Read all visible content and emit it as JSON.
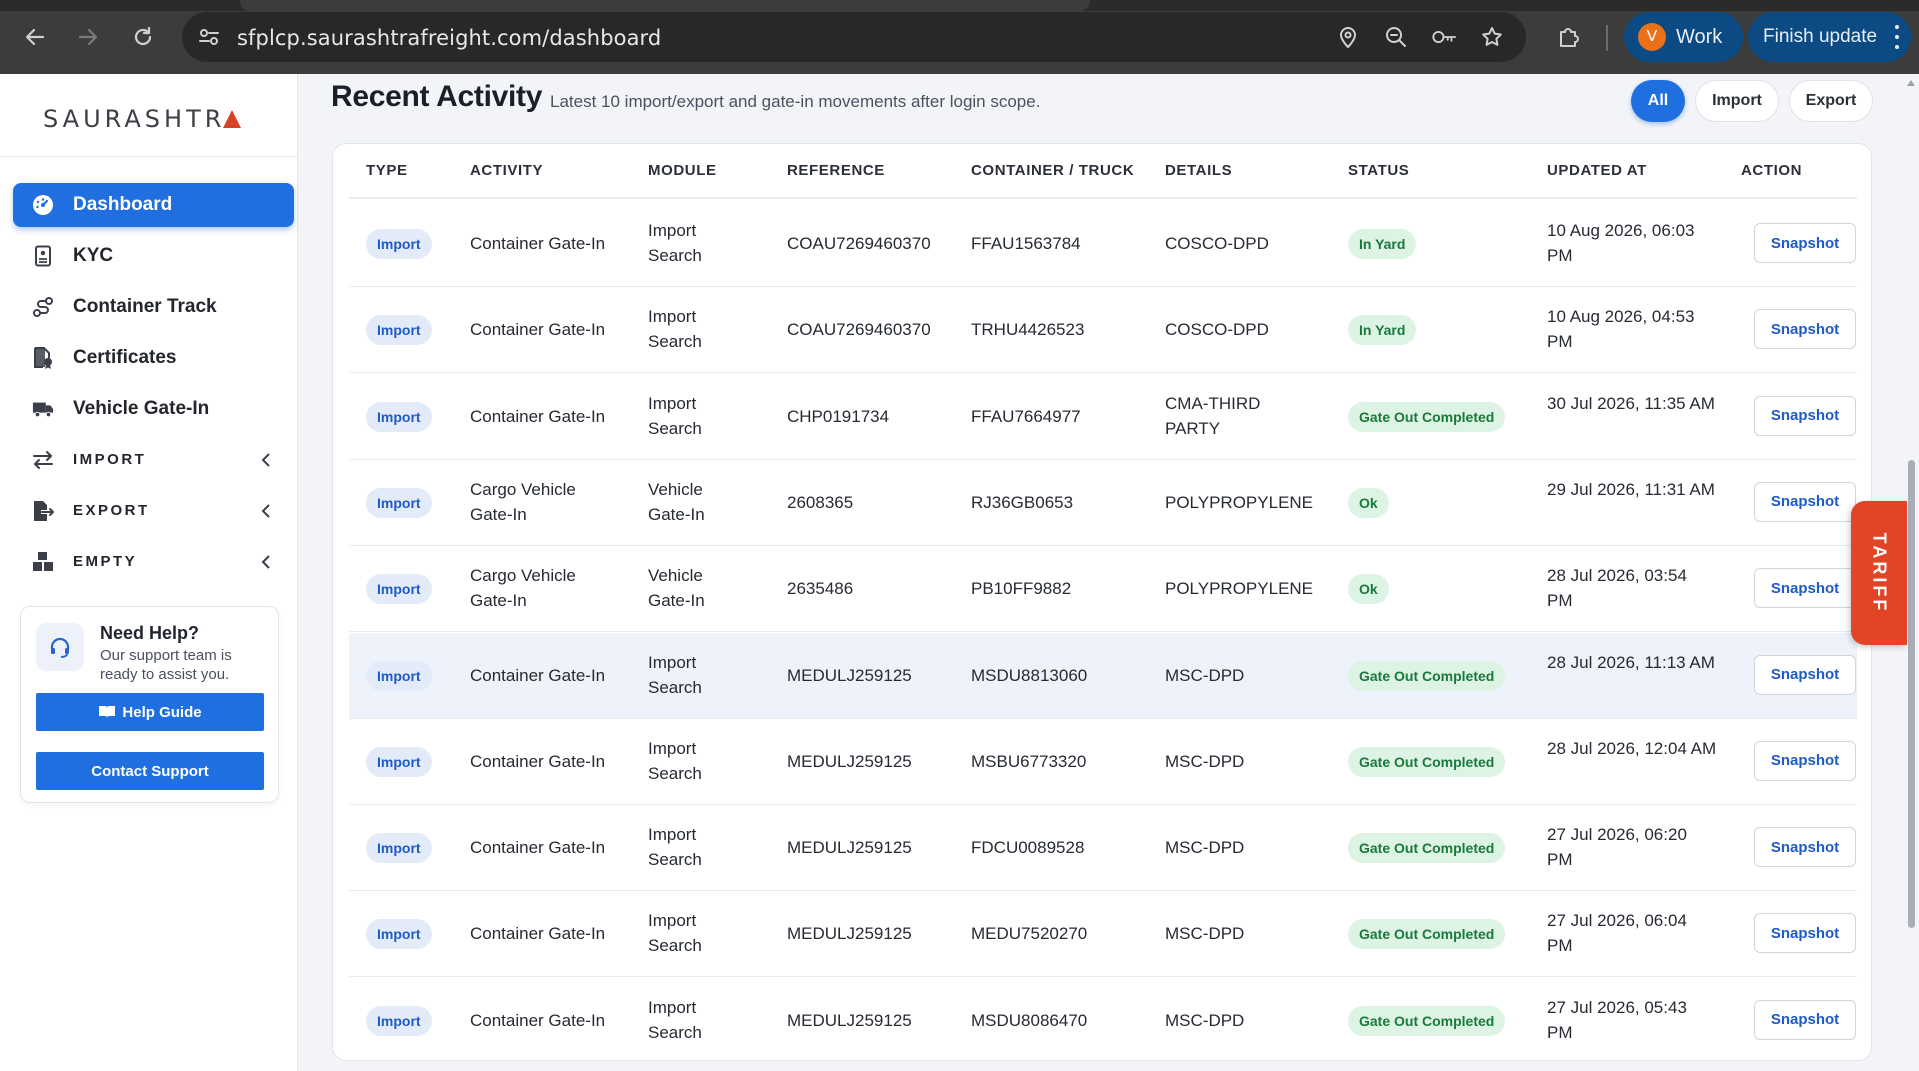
{
  "browser": {
    "url": "sfplcp.saurashtrafreight.com/dashboard",
    "profile_initial": "V",
    "profile_label": "Work",
    "update_label": "Finish update"
  },
  "sidebar": {
    "logo_text": "SAURASHTR",
    "items": [
      {
        "label": "Dashboard",
        "icon": "dashboard-gauge-icon",
        "active": true
      },
      {
        "label": "KYC",
        "icon": "id-card-icon",
        "active": false
      },
      {
        "label": "Container Track",
        "icon": "route-icon",
        "active": false
      },
      {
        "label": "Certificates",
        "icon": "file-certificate-icon",
        "active": false
      },
      {
        "label": "Vehicle Gate-In",
        "icon": "truck-icon",
        "active": false
      },
      {
        "label": "IMPORT",
        "icon": "arrows-exchange-icon",
        "active": false
      },
      {
        "label": "EXPORT",
        "icon": "file-export-icon",
        "active": false
      },
      {
        "label": "EMPTY",
        "icon": "boxes-icon",
        "active": false
      }
    ],
    "help": {
      "title": "Need Help?",
      "text": "Our support team is ready to assist you.",
      "guide_label": "Help Guide",
      "support_label": "Contact Support"
    }
  },
  "main": {
    "title": "Recent Activity",
    "subtitle": "Latest 10 import/export and gate-in movements after login scope.",
    "filters": [
      "All",
      "Import",
      "Export"
    ],
    "active_filter": "All",
    "columns": [
      "TYPE",
      "ACTIVITY",
      "MODULE",
      "REFERENCE",
      "CONTAINER / TRUCK",
      "DETAILS",
      "STATUS",
      "UPDATED AT",
      "ACTION"
    ],
    "rows": [
      {
        "type": "Import",
        "activity": "Container Gate-In",
        "module": "Import Search",
        "reference": "COAU7269460370",
        "container": "FFAU1563784",
        "details": "COSCO-DPD",
        "status": "In Yard",
        "updated": "10 Aug 2026, 06:03 PM",
        "action": "Snapshot"
      },
      {
        "type": "Import",
        "activity": "Container Gate-In",
        "module": "Import Search",
        "reference": "COAU7269460370",
        "container": "TRHU4426523",
        "details": "COSCO-DPD",
        "status": "In Yard",
        "updated": "10 Aug 2026, 04:53 PM",
        "action": "Snapshot"
      },
      {
        "type": "Import",
        "activity": "Container Gate-In",
        "module": "Import Search",
        "reference": "CHP0191734",
        "container": "FFAU7664977",
        "details": "CMA-THIRD PARTY",
        "status": "Gate Out Completed",
        "updated": "30 Jul 2026, 11:35 AM",
        "action": "Snapshot"
      },
      {
        "type": "Import",
        "activity": "Cargo Vehicle Gate-In",
        "module": "Vehicle Gate-In",
        "reference": "2608365",
        "container": "RJ36GB0653",
        "details": "POLYPROPYLENE",
        "status": "Ok",
        "updated": "29 Jul 2026, 11:31 AM",
        "action": "Snapshot"
      },
      {
        "type": "Import",
        "activity": "Cargo Vehicle Gate-In",
        "module": "Vehicle Gate-In",
        "reference": "2635486",
        "container": "PB10FF9882",
        "details": "POLYPROPYLENE",
        "status": "Ok",
        "updated": "28 Jul 2026, 03:54 PM",
        "action": "Snapshot"
      },
      {
        "type": "Import",
        "activity": "Container Gate-In",
        "module": "Import Search",
        "reference": "MEDULJ259125",
        "container": "MSDU8813060",
        "details": "MSC-DPD",
        "status": "Gate Out Completed",
        "updated": "28 Jul 2026, 11:13 AM",
        "action": "Snapshot"
      },
      {
        "type": "Import",
        "activity": "Container Gate-In",
        "module": "Import Search",
        "reference": "MEDULJ259125",
        "container": "MSBU6773320",
        "details": "MSC-DPD",
        "status": "Gate Out Completed",
        "updated": "28 Jul 2026, 12:04 AM",
        "action": "Snapshot"
      },
      {
        "type": "Import",
        "activity": "Container Gate-In",
        "module": "Import Search",
        "reference": "MEDULJ259125",
        "container": "FDCU0089528",
        "details": "MSC-DPD",
        "status": "Gate Out Completed",
        "updated": "27 Jul 2026, 06:20 PM",
        "action": "Snapshot"
      },
      {
        "type": "Import",
        "activity": "Container Gate-In",
        "module": "Import Search",
        "reference": "MEDULJ259125",
        "container": "MEDU7520270",
        "details": "MSC-DPD",
        "status": "Gate Out Completed",
        "updated": "27 Jul 2026, 06:04 PM",
        "action": "Snapshot"
      },
      {
        "type": "Import",
        "activity": "Container Gate-In",
        "module": "Import Search",
        "reference": "MEDULJ259125",
        "container": "MSDU8086470",
        "details": "MSC-DPD",
        "status": "Gate Out Completed",
        "updated": "27 Jul 2026, 05:43 PM",
        "action": "Snapshot"
      }
    ]
  },
  "tariff_label": "TARIFF",
  "colors": {
    "accent": "#1f6fe0",
    "tariff": "#e24526",
    "status_bg": "#ddf3e4",
    "status_text": "#197a3c",
    "import_badge_bg": "#e3ebf9"
  }
}
